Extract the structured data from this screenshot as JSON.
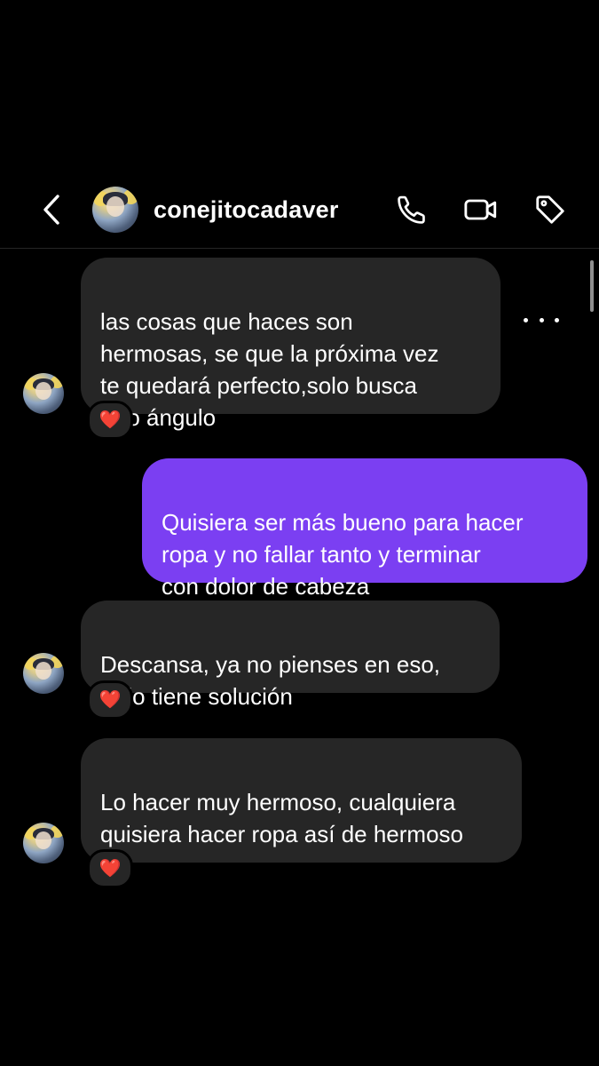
{
  "header": {
    "username": "conejitocadaver",
    "icons": {
      "back": "chevron-left-icon",
      "call": "phone-icon",
      "video": "video-camera-icon",
      "tag": "tag-icon"
    }
  },
  "messages": [
    {
      "direction": "received",
      "text": "las cosas que haces son\nhermosas, se que la próxima vez\nte quedará perfecto,solo busca\notro ángulo",
      "reaction": "❤️"
    },
    {
      "direction": "sent",
      "text": "Quisiera ser más bueno para hacer\nropa y no fallar tanto y terminar\ncon dolor de cabeza"
    },
    {
      "direction": "received",
      "text": "Descansa, ya no pienses en eso,\ntodo tiene solución",
      "reaction": "❤️"
    },
    {
      "direction": "received",
      "text": "Lo hacer muy hermoso, cualquiera\nquisiera hacer ropa así de hermoso",
      "reaction": "❤️"
    }
  ],
  "colors": {
    "background": "#000000",
    "received_bubble": "#262626",
    "sent_bubble": "#7b3ff2",
    "text": "#ffffff"
  }
}
